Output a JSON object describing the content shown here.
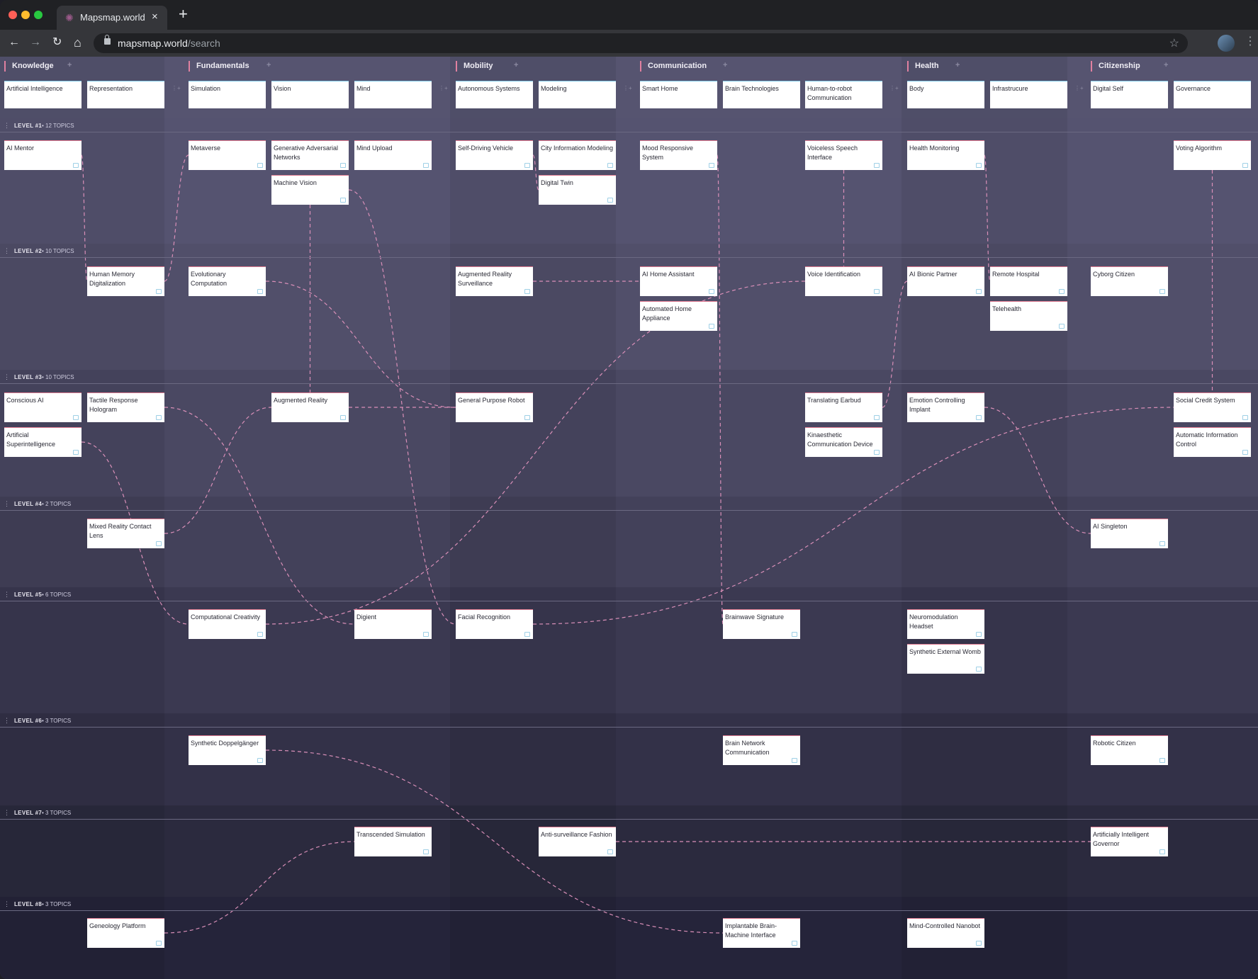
{
  "browser": {
    "tab_title": "Mapsmap.world",
    "tab_close": "×",
    "new_tab": "+",
    "url_host": "mapsmap.world",
    "url_path": "/search",
    "back": "←",
    "forward": "→",
    "reload": "↻",
    "home": "⌂",
    "star": "☆",
    "menu": "⋮"
  },
  "categories": [
    {
      "label": "Knowledge",
      "subs": [
        "Artificial Intelligence",
        "Representation"
      ]
    },
    {
      "label": "Fundamentals",
      "subs": [
        "Simulation",
        "Vision",
        "Mind"
      ]
    },
    {
      "label": "Mobility",
      "subs": [
        "Autonomous Systems",
        "Modeling"
      ]
    },
    {
      "label": "Communication",
      "subs": [
        "Smart Home",
        "Brain Technologies",
        "Human-to-robot Communication"
      ]
    },
    {
      "label": "Health",
      "subs": [
        "Body",
        "Infrastrucure"
      ]
    },
    {
      "label": "Citizenship",
      "subs": [
        "Digital Self",
        "Governance"
      ]
    }
  ],
  "levels": [
    {
      "label": "LEVEL #1",
      "count": "12 TOPICS"
    },
    {
      "label": "LEVEL #2",
      "count": "10 TOPICS"
    },
    {
      "label": "LEVEL #3",
      "count": "10 TOPICS"
    },
    {
      "label": "LEVEL #4",
      "count": "2 TOPICS"
    },
    {
      "label": "LEVEL #5",
      "count": "6 TOPICS"
    },
    {
      "label": "LEVEL #6",
      "count": "3 TOPICS"
    },
    {
      "label": "LEVEL #7",
      "count": "3 TOPICS"
    },
    {
      "label": "LEVEL #8",
      "count": "3 TOPICS"
    }
  ],
  "topics": [
    {
      "id": "t_aimentor",
      "label": "AI Mentor",
      "col": 0,
      "level": 0,
      "slot": 0
    },
    {
      "id": "t_metaverse",
      "label": "Metaverse",
      "col": 2,
      "level": 0,
      "slot": 0
    },
    {
      "id": "t_gan",
      "label": "Generative Adversarial Networks",
      "col": 3,
      "level": 0,
      "slot": 0
    },
    {
      "id": "t_machinevision",
      "label": "Machine Vision",
      "col": 3,
      "level": 0,
      "slot": 1
    },
    {
      "id": "t_mindupload",
      "label": "Mind Upload",
      "col": 4,
      "level": 0,
      "slot": 0
    },
    {
      "id": "t_selfdriving",
      "label": "Self-Driving Vehicle",
      "col": 5,
      "level": 0,
      "slot": 0
    },
    {
      "id": "t_cim",
      "label": "City Information Modeling",
      "col": 6,
      "level": 0,
      "slot": 0
    },
    {
      "id": "t_digitaltwin",
      "label": "Digital Twin",
      "col": 6,
      "level": 0,
      "slot": 1
    },
    {
      "id": "t_mood",
      "label": "Mood Responsive System",
      "col": 7,
      "level": 0,
      "slot": 0
    },
    {
      "id": "t_voiceless",
      "label": "Voiceless Speech Interface",
      "col": 9,
      "level": 0,
      "slot": 0
    },
    {
      "id": "t_healthmon",
      "label": "Health Monitoring",
      "col": 10,
      "level": 0,
      "slot": 0
    },
    {
      "id": "t_voting",
      "label": "Voting Algorithm",
      "col": 13,
      "level": 0,
      "slot": 0
    },
    {
      "id": "t_humanmem",
      "label": "Human Memory Digitalization",
      "col": 1,
      "level": 1,
      "slot": 0
    },
    {
      "id": "t_evocomp",
      "label": "Evolutionary Computation",
      "col": 2,
      "level": 1,
      "slot": 0
    },
    {
      "id": "t_arsurv",
      "label": "Augmented Reality Surveillance",
      "col": 5,
      "level": 1,
      "slot": 0
    },
    {
      "id": "t_aihome",
      "label": "AI Home Assistant",
      "col": 7,
      "level": 1,
      "slot": 0
    },
    {
      "id": "t_autohome",
      "label": "Automated Home Appliance",
      "col": 7,
      "level": 1,
      "slot": 1
    },
    {
      "id": "t_voiceid",
      "label": "Voice Identification",
      "col": 9,
      "level": 1,
      "slot": 0
    },
    {
      "id": "t_bionic",
      "label": "AI Bionic Partner",
      "col": 10,
      "level": 1,
      "slot": 0
    },
    {
      "id": "t_remotehosp",
      "label": "Remote Hospital",
      "col": 11,
      "level": 1,
      "slot": 0
    },
    {
      "id": "t_telehealth",
      "label": "Telehealth",
      "col": 11,
      "level": 1,
      "slot": 1
    },
    {
      "id": "t_cyborg",
      "label": "Cyborg Citizen",
      "col": 12,
      "level": 1,
      "slot": 0
    },
    {
      "id": "t_consciousai",
      "label": "Conscious AI",
      "col": 0,
      "level": 2,
      "slot": 0
    },
    {
      "id": "t_asi",
      "label": "Artificial Superintelligence",
      "col": 0,
      "level": 2,
      "slot": 1
    },
    {
      "id": "t_tactile",
      "label": "Tactile Response Hologram",
      "col": 1,
      "level": 2,
      "slot": 0
    },
    {
      "id": "t_ar",
      "label": "Augmented Reality",
      "col": 3,
      "level": 2,
      "slot": 0
    },
    {
      "id": "t_gprobot",
      "label": "General Purpose Robot",
      "col": 5,
      "level": 2,
      "slot": 0
    },
    {
      "id": "t_earbud",
      "label": "Translating Earbud",
      "col": 9,
      "level": 2,
      "slot": 0
    },
    {
      "id": "t_kinaes",
      "label": "Kinaesthetic Communication Device",
      "col": 9,
      "level": 2,
      "slot": 1
    },
    {
      "id": "t_emotion",
      "label": "Emotion Controlling Implant",
      "col": 10,
      "level": 2,
      "slot": 0
    },
    {
      "id": "t_socialcredit",
      "label": "Social Credit System",
      "col": 13,
      "level": 2,
      "slot": 0
    },
    {
      "id": "t_autoinfo",
      "label": "Automatic Information Control",
      "col": 13,
      "level": 2,
      "slot": 1
    },
    {
      "id": "t_mrlens",
      "label": "Mixed Reality Contact Lens",
      "col": 1,
      "level": 3,
      "slot": 0
    },
    {
      "id": "t_singleton",
      "label": "AI Singleton",
      "col": 12,
      "level": 3,
      "slot": 0
    },
    {
      "id": "t_compcreat",
      "label": "Computational Creativity",
      "col": 2,
      "level": 4,
      "slot": 0
    },
    {
      "id": "t_digient",
      "label": "Digient",
      "col": 4,
      "level": 4,
      "slot": 0
    },
    {
      "id": "t_facial",
      "label": "Facial Recognition",
      "col": 5,
      "level": 4,
      "slot": 0
    },
    {
      "id": "t_brainwave",
      "label": "Brainwave Signature",
      "col": 8,
      "level": 4,
      "slot": 0
    },
    {
      "id": "t_neuromod",
      "label": "Neuromodulation Headset",
      "col": 10,
      "level": 4,
      "slot": 0
    },
    {
      "id": "t_womb",
      "label": "Synthetic External Womb",
      "col": 10,
      "level": 4,
      "slot": 1
    },
    {
      "id": "t_doppel",
      "label": "Synthetic Doppelgänger",
      "col": 2,
      "level": 5,
      "slot": 0
    },
    {
      "id": "t_brainnet",
      "label": "Brain Network Communication",
      "col": 8,
      "level": 5,
      "slot": 0
    },
    {
      "id": "t_robotcit",
      "label": "Robotic Citizen",
      "col": 12,
      "level": 5,
      "slot": 0
    },
    {
      "id": "t_transsim",
      "label": "Transcended Simulation",
      "col": 4,
      "level": 6,
      "slot": 0
    },
    {
      "id": "t_antisurv",
      "label": "Anti-surveillance Fashion",
      "col": 6,
      "level": 6,
      "slot": 0
    },
    {
      "id": "t_aigov",
      "label": "Artificially Intelligent Governor",
      "col": 12,
      "level": 6,
      "slot": 0
    },
    {
      "id": "t_geneology",
      "label": "Geneology Platform",
      "col": 1,
      "level": 7,
      "slot": 0
    },
    {
      "id": "t_implant",
      "label": "Implantable Brain-Machine Interface",
      "col": 8,
      "level": 7,
      "slot": 0
    },
    {
      "id": "t_nanobot",
      "label": "Mind-Controlled Nanobot",
      "col": 10,
      "level": 7,
      "slot": 0
    }
  ],
  "links": [
    [
      "t_aimentor",
      "t_humanmem"
    ],
    [
      "t_humanmem",
      "t_metaverse"
    ],
    [
      "t_machinevision",
      "t_ar"
    ],
    [
      "t_machinevision",
      "t_facial"
    ],
    [
      "t_selfdriving",
      "t_digitaltwin"
    ],
    [
      "t_arsurv",
      "t_aihome"
    ],
    [
      "t_evocomp",
      "t_gprobot"
    ],
    [
      "t_ar",
      "t_gprobot"
    ],
    [
      "t_mood",
      "t_brainwave"
    ],
    [
      "t_voiceless",
      "t_voiceid"
    ],
    [
      "t_healthmon",
      "t_remotehosp"
    ],
    [
      "t_voting",
      "t_socialcredit"
    ],
    [
      "t_bionic",
      "t_earbud"
    ],
    [
      "t_emotion",
      "t_singleton"
    ],
    [
      "t_mrlens",
      "t_ar"
    ],
    [
      "t_tactile",
      "t_digient"
    ],
    [
      "t_asi",
      "t_compcreat"
    ],
    [
      "t_compcreat",
      "t_voiceid"
    ],
    [
      "t_facial",
      "t_socialcredit"
    ],
    [
      "t_doppel",
      "t_implant"
    ],
    [
      "t_geneology",
      "t_transsim"
    ],
    [
      "t_antisurv",
      "t_aigov"
    ]
  ],
  "colors": {
    "link": "#d98fb8",
    "card_accent": "#e07a90",
    "sub_accent": "#7ec8e6",
    "category_bar": "#e080a0"
  }
}
